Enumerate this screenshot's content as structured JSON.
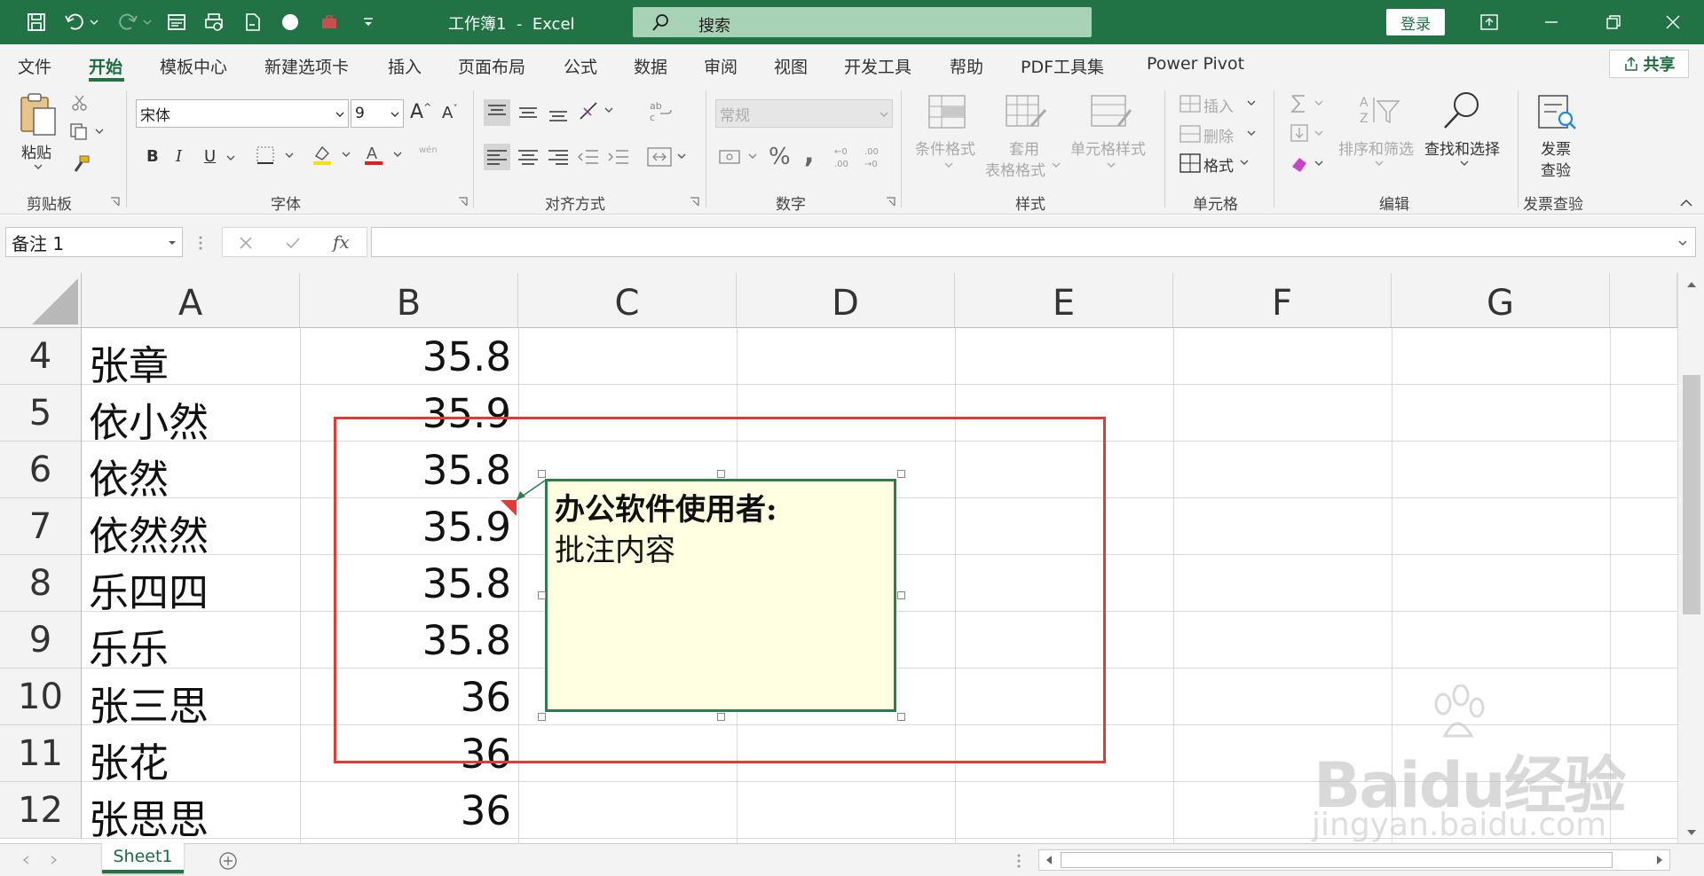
{
  "titlebar": {
    "title": "工作簿1  -  Excel",
    "search_placeholder": "搜索",
    "login": "登录"
  },
  "menu": {
    "tabs": [
      "文件",
      "开始",
      "模板中心",
      "新建选项卡",
      "插入",
      "页面布局",
      "公式",
      "数据",
      "审阅",
      "视图",
      "开发工具",
      "帮助",
      "PDF工具集",
      "Power Pivot"
    ],
    "active": "开始",
    "share": "共享"
  },
  "ribbon": {
    "clipboard": {
      "label": "剪贴板",
      "paste": "粘贴"
    },
    "font": {
      "label": "字体",
      "font_name": "宋体",
      "font_size": "9",
      "bold": "B",
      "italic": "I",
      "underline": "U",
      "wen": "wén"
    },
    "align": {
      "label": "对齐方式"
    },
    "number": {
      "label": "数字",
      "format": "常规",
      "percent": "%",
      "comma": ","
    },
    "styles": {
      "label": "样式",
      "cond": "条件格式",
      "table_a": "套用",
      "table_b": "表格格式",
      "cell_style": "单元格样式"
    },
    "cells": {
      "label": "单元格",
      "insert": "插入",
      "delete": "删除",
      "format": "格式"
    },
    "edit": {
      "label": "编辑",
      "sort": "排序和筛选",
      "find": "查找和选择"
    },
    "invoice": {
      "label": "发票查验",
      "a": "发票",
      "b": "查验"
    }
  },
  "formula": {
    "namebox": "备注 1",
    "fx": "fx"
  },
  "grid": {
    "columns": [
      "A",
      "B",
      "C",
      "D",
      "E",
      "F",
      "G"
    ],
    "rows": [
      {
        "num": "4",
        "name": "张章",
        "value": "35.8"
      },
      {
        "num": "5",
        "name": "依小然",
        "value": "35.9"
      },
      {
        "num": "6",
        "name": "依然",
        "value": "35.8"
      },
      {
        "num": "7",
        "name": "依然然",
        "value": "35.9"
      },
      {
        "num": "8",
        "name": "乐四四",
        "value": "35.8"
      },
      {
        "num": "9",
        "name": "乐乐",
        "value": "35.8"
      },
      {
        "num": "10",
        "name": "张三思",
        "value": "36"
      },
      {
        "num": "11",
        "name": "张花",
        "value": "36"
      },
      {
        "num": "12",
        "name": "张思思",
        "value": "36"
      }
    ]
  },
  "comment": {
    "author": "办公软件使用者:",
    "body": "批注内容"
  },
  "sheets": {
    "tab": "Sheet1"
  },
  "watermark": {
    "text": "Baidu经验",
    "sub": "jingyan.baidu.com"
  },
  "colors": {
    "excel_green": "#217346",
    "comment_bg": "#ffffe1",
    "highlight_red": "#e53935"
  }
}
